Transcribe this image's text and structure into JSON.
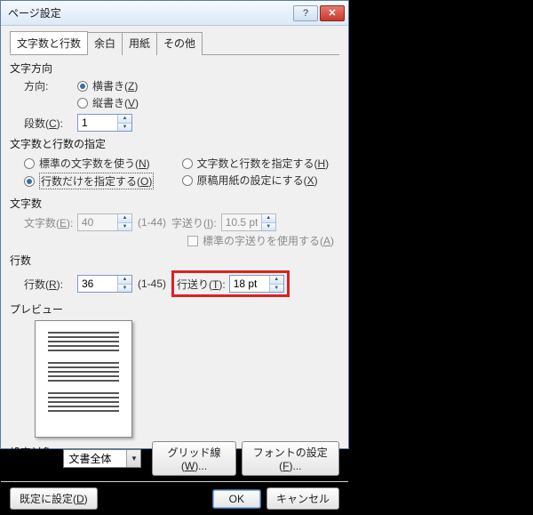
{
  "title": "ページ設定",
  "tabs": [
    "文字数と行数",
    "余白",
    "用紙",
    "その他"
  ],
  "direction": {
    "section": "文字方向",
    "label": "方向:",
    "horizontal": "横書き(Z)",
    "vertical": "縦書き(V)",
    "columns_label": "段数(C):",
    "columns_value": "1"
  },
  "spec": {
    "section": "文字数と行数の指定",
    "opt_standard": "標準の文字数を使う(N)",
    "opt_chars_lines": "文字数と行数を指定する(H)",
    "opt_lines_only": "行数だけを指定する(O)",
    "opt_genko": "原稿用紙の設定にする(X)"
  },
  "chars": {
    "section": "文字数",
    "label": "文字数(E):",
    "value": "40",
    "range": "(1-44)",
    "pitch_label": "字送り(I):",
    "pitch_value": "10.5 pt",
    "use_standard": "標準の字送りを使用する(A)"
  },
  "lines": {
    "section": "行数",
    "label": "行数(R):",
    "value": "36",
    "range": "(1-45)",
    "pitch_label": "行送り(T):",
    "pitch_value": "18 pt"
  },
  "preview": {
    "section": "プレビュー"
  },
  "bottom": {
    "target_label": "設定対象(Y):",
    "target_value": "文書全体",
    "grid_btn": "グリッド線(W)...",
    "font_btn": "フォントの設定(F)..."
  },
  "footer": {
    "default_btn": "既定に設定(D)",
    "ok": "OK",
    "cancel": "キャンセル"
  }
}
